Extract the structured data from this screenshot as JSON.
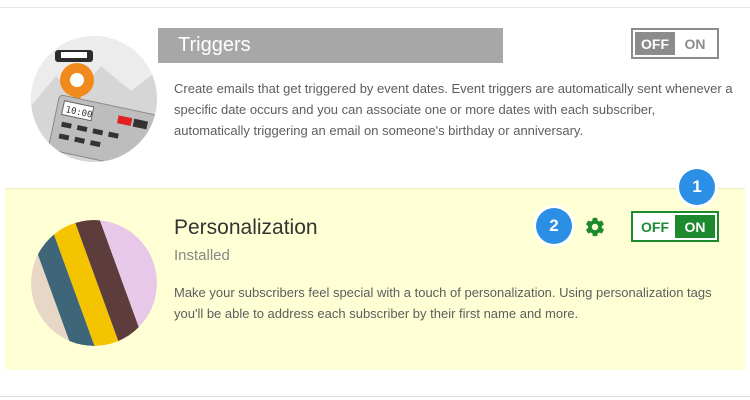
{
  "triggers": {
    "title": "Triggers",
    "description": "Create emails that get triggered by event dates. Event triggers are automatically sent whenever a specific date occurs and you can associate one or more dates with each subscriber, automatically triggering an email on someone's birthday or anniversary.",
    "image_clock_text": "10:00",
    "toggle": {
      "off_label": "OFF",
      "on_label": "ON",
      "state": "off"
    }
  },
  "personalization": {
    "title": "Personalization",
    "status": "Installed",
    "description": "Make your subscribers feel special with a touch of personalization. Using personalization tags you'll be able to address each subscriber by their first name and more.",
    "toggle": {
      "off_label": "OFF",
      "on_label": "ON",
      "state": "on"
    },
    "settings_icon": "gear-icon"
  },
  "badges": {
    "first": "1",
    "second": "2"
  },
  "colors": {
    "highlight_bg": "#ffffd6",
    "active_green": "#1d8a2e",
    "inactive_gray": "#8c8c8c",
    "badge_blue": "#2b8fe6",
    "title_band_gray": "#a7a7a7"
  }
}
